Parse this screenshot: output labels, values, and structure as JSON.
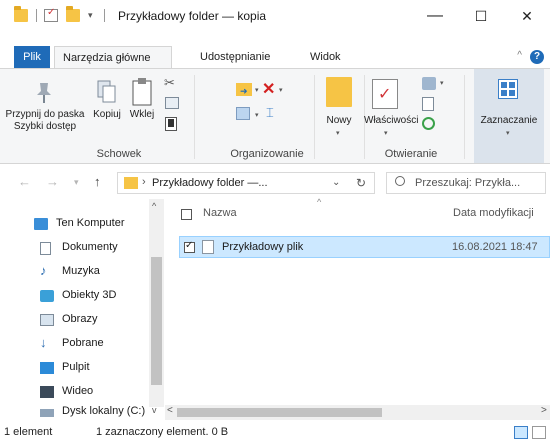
{
  "window": {
    "title": "Przykładowy folder — kopia",
    "minimize": "—",
    "maximize": "☐",
    "close": "✕"
  },
  "ribbon": {
    "tabs": [
      "Plik",
      "Narzędzia główne",
      "Udostępnianie",
      "Widok"
    ],
    "active_tab": "Narzędzia główne",
    "help": "?",
    "groups": {
      "clipboard": {
        "label": "Schowek",
        "pin_label_line1": "Przypnij do paska",
        "pin_label_line2": "Szybki dostęp",
        "copy": "Kopiuj",
        "paste": "Wklej"
      },
      "organize": {
        "label": "Organizowanie"
      },
      "new": {
        "new_label": "Nowy"
      },
      "open": {
        "label": "Otwieranie",
        "properties": "Właściwości"
      },
      "select": {
        "select_label": "Zaznaczanie"
      }
    }
  },
  "address": {
    "path": "Przykładowy folder —...",
    "search_placeholder": "Przeszukaj: Przykła..."
  },
  "nav": {
    "items": [
      {
        "label": "Ten Komputer",
        "icon": "computer-icon"
      },
      {
        "label": "Dokumenty",
        "icon": "documents-icon"
      },
      {
        "label": "Muzyka",
        "icon": "music-icon"
      },
      {
        "label": "Obiekty 3D",
        "icon": "3d-objects-icon"
      },
      {
        "label": "Obrazy",
        "icon": "pictures-icon"
      },
      {
        "label": "Pobrane",
        "icon": "downloads-icon"
      },
      {
        "label": "Pulpit",
        "icon": "desktop-icon"
      },
      {
        "label": "Wideo",
        "icon": "video-icon"
      },
      {
        "label": "Dysk lokalny (C:)",
        "icon": "drive-icon"
      }
    ]
  },
  "list": {
    "columns": [
      "Nazwa",
      "Data modyfikacji"
    ],
    "rows": [
      {
        "name": "Przykładowy plik",
        "modified": "16.08.2021 18:47",
        "selected": true
      }
    ]
  },
  "status": {
    "count": "1 element",
    "selection": "1 zaznaczony element. 0 B"
  },
  "colors": {
    "accent": "#1f6bb8",
    "selection_bg": "#cce8ff",
    "folder": "#f6c445"
  }
}
